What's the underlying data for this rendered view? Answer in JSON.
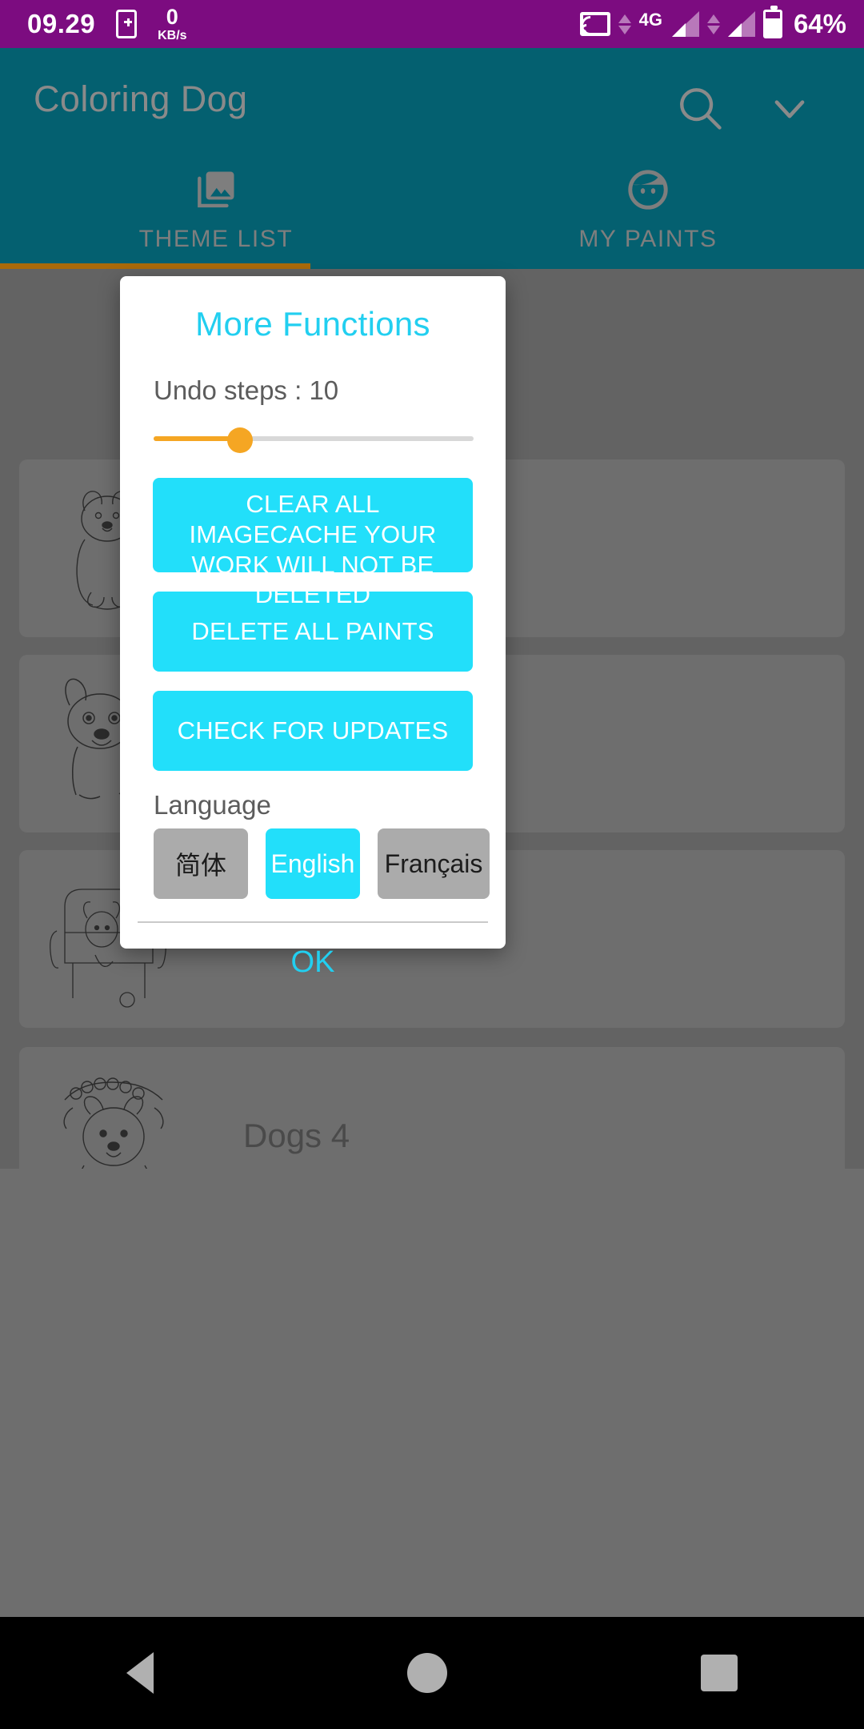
{
  "status_bar": {
    "clock": "09.29",
    "net_speed_value": "0",
    "net_speed_unit": "KB/s",
    "network_type": "4G",
    "battery_percent": "64%",
    "icons": [
      "sim-card-icon",
      "cast-icon",
      "signal-icon",
      "battery-icon"
    ],
    "background_color": "#7C0C80"
  },
  "app_bar": {
    "title": "Coloring Dog",
    "background_color": "#046070",
    "search_icon": "search-icon",
    "overflow_icon": "chevron-down-icon",
    "tabs": [
      {
        "label": "THEME LIST",
        "icon": "photo-library-icon",
        "selected": true
      },
      {
        "label": "MY PAINTS",
        "icon": "face-icon",
        "selected": false
      }
    ],
    "indicator_color": "#AA6A0A"
  },
  "background_list": {
    "cards": [
      {
        "title": "",
        "art": "dog-sitting-drawing"
      },
      {
        "title": "",
        "art": "bulldog-drawing"
      },
      {
        "title": "",
        "art": "dog-on-armchair-drawing"
      },
      {
        "title": "Dogs 4",
        "art": "dog-with-flowers-drawing"
      }
    ]
  },
  "dialog": {
    "title": "More Functions",
    "undo_label": "Undo steps : 10",
    "undo_value": 10,
    "slider": {
      "min": 0,
      "max": 36,
      "value": 10,
      "fill_color": "#F5A623"
    },
    "buttons": [
      {
        "id": "clear-cache",
        "label": "CLEAR ALL IMAGECACHE YOUR WORK WILL NOT BE DELETED"
      },
      {
        "id": "delete-paints",
        "label": "DELETE ALL PAINTS"
      },
      {
        "id": "check-updates",
        "label": "CHECK FOR UPDATES"
      }
    ],
    "language_label": "Language",
    "languages": [
      {
        "code": "zh",
        "label": "简体",
        "selected": false
      },
      {
        "code": "en",
        "label": "English",
        "selected": true
      },
      {
        "code": "fr",
        "label": "Français",
        "selected": false
      }
    ],
    "ok_label": "OK",
    "accent_color": "#22DFFA",
    "title_color": "#22CFF0"
  },
  "nav_bar": {
    "back_icon": "back-triangle-icon",
    "home_icon": "home-circle-icon",
    "recents_icon": "recents-square-icon"
  }
}
